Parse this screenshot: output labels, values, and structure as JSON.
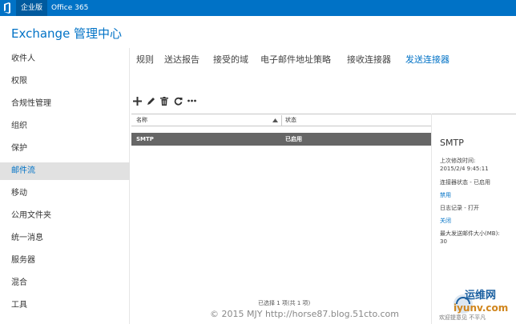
{
  "topbar": {
    "edition_tab": "企业版",
    "o365_tab": "Office 365"
  },
  "app": {
    "title": "Exchange 管理中心"
  },
  "sidebar": {
    "items": [
      {
        "label": "收件人"
      },
      {
        "label": "权限"
      },
      {
        "label": "合规性管理"
      },
      {
        "label": "组织"
      },
      {
        "label": "保护"
      },
      {
        "label": "邮件流",
        "active": true
      },
      {
        "label": "移动"
      },
      {
        "label": "公用文件夹"
      },
      {
        "label": "统一消息"
      },
      {
        "label": "服务器"
      },
      {
        "label": "混合"
      },
      {
        "label": "工具"
      }
    ]
  },
  "subnav": {
    "items": [
      {
        "label": "规则"
      },
      {
        "label": "送达报告"
      },
      {
        "label": "接受的域"
      },
      {
        "label": "电子邮件地址策略"
      },
      {
        "label": "接收连接器"
      },
      {
        "label": "发送连接器",
        "active": true
      }
    ]
  },
  "toolbar": {
    "icons": [
      "add-icon",
      "edit-icon",
      "delete-icon",
      "refresh-icon",
      "more-icon"
    ]
  },
  "grid": {
    "columns": [
      "名称",
      "状态"
    ],
    "rows": [
      {
        "name": "SMTP",
        "status": "已启用",
        "selected": true
      }
    ],
    "footer": "已选择 1 项(共 1 项)"
  },
  "details": {
    "title": "SMTP",
    "modified_label": "上次修改时间:",
    "modified_value": "2015/2/4 9:45:11",
    "connector_status": "连接器状态 - 已启用",
    "disable_link": "禁用",
    "logging": "日志记录 - 打开",
    "close_link": "关闭",
    "max_size_label": "最大发送邮件大小(MB):",
    "max_size_value": "30"
  },
  "watermark": {
    "site_name": "运维网",
    "site_domain": "iyunv.com",
    "note": "欢迎提意见 不平凡",
    "copyright": "© 2015 MJY http://horse87.blog.51cto.com"
  },
  "colors": {
    "accent": "#0072c6",
    "selected_row": "#666666",
    "nav_active_bg": "#e1e1e1"
  }
}
